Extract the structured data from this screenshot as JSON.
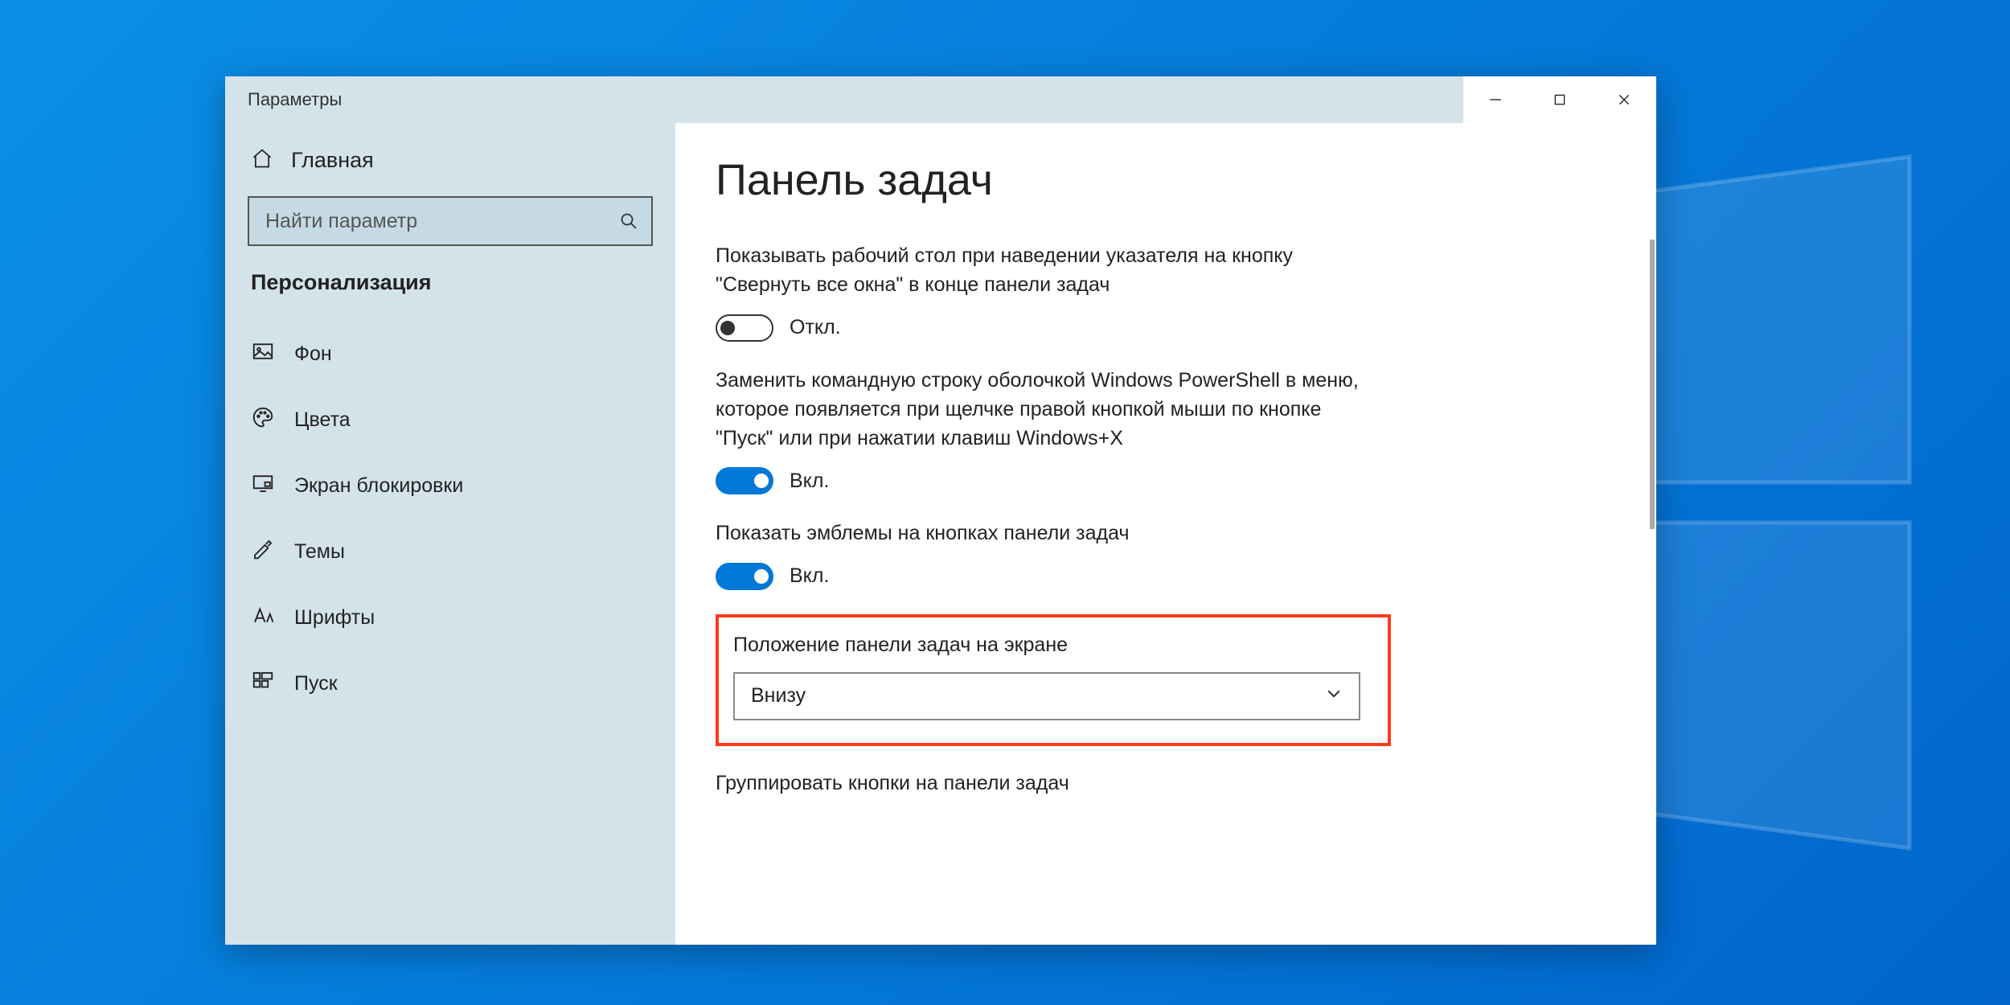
{
  "window": {
    "title": "Параметры"
  },
  "sidebar": {
    "home": "Главная",
    "search_placeholder": "Найти параметр",
    "section": "Персонализация",
    "items": [
      {
        "label": "Фон"
      },
      {
        "label": "Цвета"
      },
      {
        "label": "Экран блокировки"
      },
      {
        "label": "Темы"
      },
      {
        "label": "Шрифты"
      },
      {
        "label": "Пуск"
      }
    ]
  },
  "content": {
    "title": "Панель задач",
    "setting1": {
      "desc": "Показывать рабочий стол при наведении указателя на кнопку \"Свернуть все окна\" в конце панели задач",
      "state_label": "Откл."
    },
    "setting2": {
      "desc": "Заменить командную строку оболочкой Windows PowerShell в меню, которое появляется при щелчке правой кнопкой мыши по кнопке \"Пуск\" или при нажатии клавиш Windows+X",
      "state_label": "Вкл."
    },
    "setting3": {
      "desc": "Показать эмблемы на кнопках панели задач",
      "state_label": "Вкл."
    },
    "position": {
      "label": "Положение панели задач на экране",
      "value": "Внизу"
    },
    "grouping": {
      "label": "Группировать кнопки на панели задач"
    }
  }
}
